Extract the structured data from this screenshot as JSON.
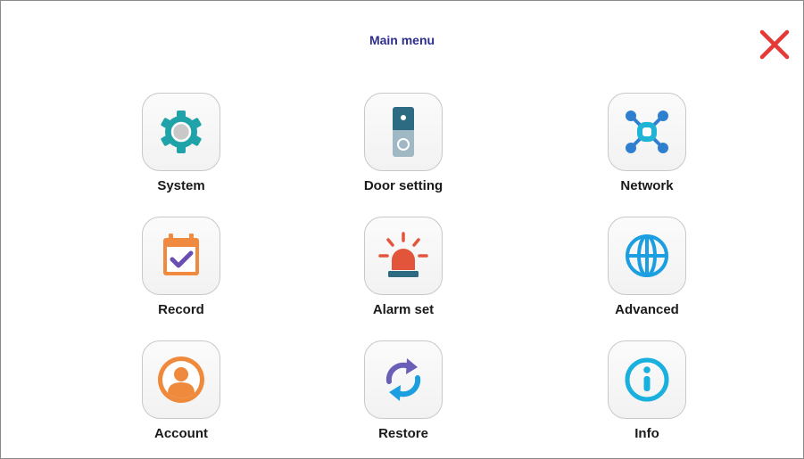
{
  "header": {
    "title": "Main menu"
  },
  "menu": {
    "items": [
      {
        "label": "System",
        "icon": "gear-icon"
      },
      {
        "label": "Door setting",
        "icon": "doorbell-icon"
      },
      {
        "label": "Network",
        "icon": "network-icon"
      },
      {
        "label": "Record",
        "icon": "calendar-check-icon"
      },
      {
        "label": "Alarm set",
        "icon": "alarm-light-icon"
      },
      {
        "label": "Advanced",
        "icon": "globe-icon"
      },
      {
        "label": "Account",
        "icon": "user-icon"
      },
      {
        "label": "Restore",
        "icon": "refresh-icon"
      },
      {
        "label": "Info",
        "icon": "info-icon"
      }
    ]
  },
  "colors": {
    "title": "#2e2e8f",
    "close": "#e53935",
    "system": "#1fa3a8",
    "door": "#2d6b82",
    "network": "#2f7fd0",
    "record": "#f08a3e",
    "record_check": "#6a4fb3",
    "alarm": "#e2553b",
    "advanced": "#1b9fe0",
    "account": "#ef8a3c",
    "restore_a": "#6a5fb8",
    "restore_b": "#1b9fe0",
    "info": "#1ab0dd"
  }
}
